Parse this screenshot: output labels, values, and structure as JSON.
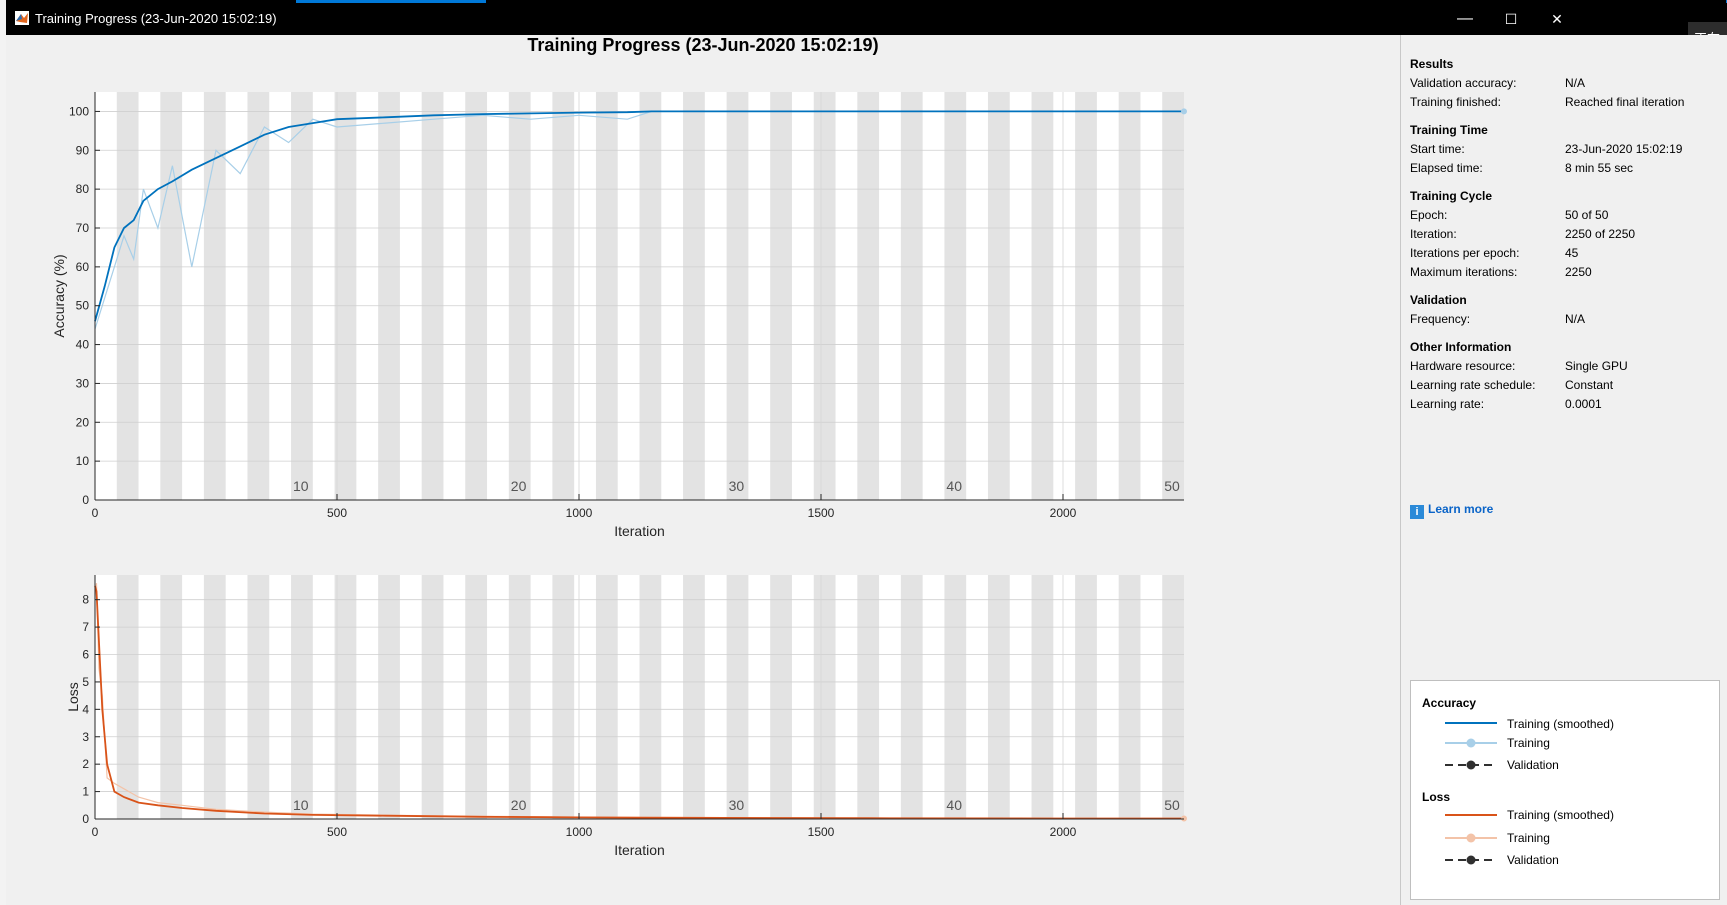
{
  "window": {
    "title": "Training Progress (23-Jun-2020 15:02:19)",
    "minimize_glyph": "—",
    "maximize_glyph": "☐",
    "close_glyph": "✕",
    "corner_badge_text": "正在"
  },
  "figure": {
    "title": "Training Progress (23-Jun-2020 15:02:19)"
  },
  "results_panel": {
    "sections": [
      {
        "heading": "Results",
        "rows": [
          {
            "label": "Validation accuracy:",
            "value": "N/A"
          },
          {
            "label": "Training finished:",
            "value": "Reached final iteration"
          }
        ]
      },
      {
        "heading": "Training Time",
        "rows": [
          {
            "label": "Start time:",
            "value": "23-Jun-2020 15:02:19"
          },
          {
            "label": "Elapsed time:",
            "value": "8 min 55 sec"
          }
        ]
      },
      {
        "heading": "Training Cycle",
        "rows": [
          {
            "label": "Epoch:",
            "value": "50 of 50"
          },
          {
            "label": "Iteration:",
            "value": "2250 of 2250"
          },
          {
            "label": "Iterations per epoch:",
            "value": "45"
          },
          {
            "label": "Maximum iterations:",
            "value": "2250"
          }
        ]
      },
      {
        "heading": "Validation",
        "rows": [
          {
            "label": "Frequency:",
            "value": "N/A"
          }
        ]
      },
      {
        "heading": "Other Information",
        "rows": [
          {
            "label": "Hardware resource:",
            "value": "Single GPU"
          },
          {
            "label": "Learning rate schedule:",
            "value": "Constant"
          },
          {
            "label": "Learning rate:",
            "value": "0.0001"
          }
        ]
      }
    ],
    "learn_more": "Learn more",
    "info_icon": "info-icon"
  },
  "legend": {
    "accuracy_heading": "Accuracy",
    "loss_heading": "Loss",
    "accuracy_items": [
      "Training (smoothed)",
      "Training",
      "Validation"
    ],
    "loss_items": [
      "Training (smoothed)",
      "Training",
      "Validation"
    ],
    "colors": {
      "acc_smoothed": "#0072bd",
      "acc_raw": "#a8cfe8",
      "loss_smoothed": "#d95319",
      "loss_raw": "#f3c3a8",
      "validation": "#303030"
    }
  },
  "chart_data": [
    {
      "type": "line",
      "name": "accuracy",
      "xlabel": "Iteration",
      "ylabel": "Accuracy (%)",
      "xlim": [
        0,
        2250
      ],
      "ylim": [
        0,
        105
      ],
      "xticks": [
        0,
        500,
        1000,
        1500,
        2000
      ],
      "yticks": [
        0,
        10,
        20,
        30,
        40,
        50,
        60,
        70,
        80,
        90,
        100
      ],
      "iterations_per_epoch": 45,
      "epoch_labels": [
        10,
        20,
        30,
        40,
        50
      ],
      "grid": true,
      "series": [
        {
          "name": "Training (smoothed)",
          "x": [
            0,
            20,
            40,
            60,
            80,
            100,
            130,
            160,
            200,
            250,
            300,
            350,
            400,
            450,
            500,
            600,
            700,
            800,
            900,
            1000,
            1100,
            1150,
            1200,
            1500,
            1800,
            2100,
            2250
          ],
          "values": [
            46,
            55,
            65,
            70,
            72,
            77,
            80,
            82,
            85,
            88,
            91,
            94,
            96,
            97,
            98,
            98.5,
            99,
            99.3,
            99.5,
            99.7,
            99.8,
            100,
            100,
            100,
            100,
            100,
            100
          ]
        },
        {
          "name": "Training",
          "x": [
            0,
            20,
            40,
            60,
            80,
            100,
            130,
            160,
            200,
            250,
            300,
            350,
            400,
            450,
            500,
            600,
            700,
            800,
            900,
            1000,
            1100,
            1150,
            1200,
            1500,
            1800,
            2100,
            2250
          ],
          "values": [
            44,
            52,
            60,
            68,
            62,
            80,
            70,
            86,
            60,
            90,
            84,
            96,
            92,
            98,
            96,
            97,
            98,
            99,
            98,
            99,
            98,
            100,
            100,
            100,
            100,
            100,
            100
          ]
        }
      ]
    },
    {
      "type": "line",
      "name": "loss",
      "xlabel": "Iteration",
      "ylabel": "Loss",
      "xlim": [
        0,
        2250
      ],
      "ylim": [
        0,
        8.9
      ],
      "xticks": [
        0,
        500,
        1000,
        1500,
        2000
      ],
      "yticks": [
        0,
        1,
        2,
        3,
        4,
        5,
        6,
        7,
        8
      ],
      "iterations_per_epoch": 45,
      "epoch_labels": [
        10,
        20,
        30,
        40,
        50
      ],
      "grid": true,
      "series": [
        {
          "name": "Training (smoothed)",
          "x": [
            0,
            3,
            8,
            15,
            25,
            40,
            60,
            90,
            130,
            180,
            250,
            350,
            450,
            600,
            800,
            1000,
            1300,
            1600,
            2000,
            2250
          ],
          "values": [
            8.5,
            8.3,
            6.5,
            4.0,
            2.0,
            1.0,
            0.8,
            0.6,
            0.5,
            0.4,
            0.3,
            0.2,
            0.15,
            0.12,
            0.08,
            0.06,
            0.04,
            0.03,
            0.02,
            0.02
          ]
        },
        {
          "name": "Training",
          "x": [
            0,
            3,
            8,
            15,
            25,
            40,
            60,
            90,
            130,
            180,
            250,
            350,
            450,
            600,
            800,
            1000,
            1300,
            1600,
            2000,
            2250
          ],
          "values": [
            8.2,
            8.6,
            5.5,
            4.5,
            1.5,
            1.3,
            1.1,
            0.8,
            0.6,
            0.5,
            0.35,
            0.25,
            0.18,
            0.14,
            0.1,
            0.07,
            0.05,
            0.03,
            0.02,
            0.02
          ]
        }
      ]
    }
  ]
}
